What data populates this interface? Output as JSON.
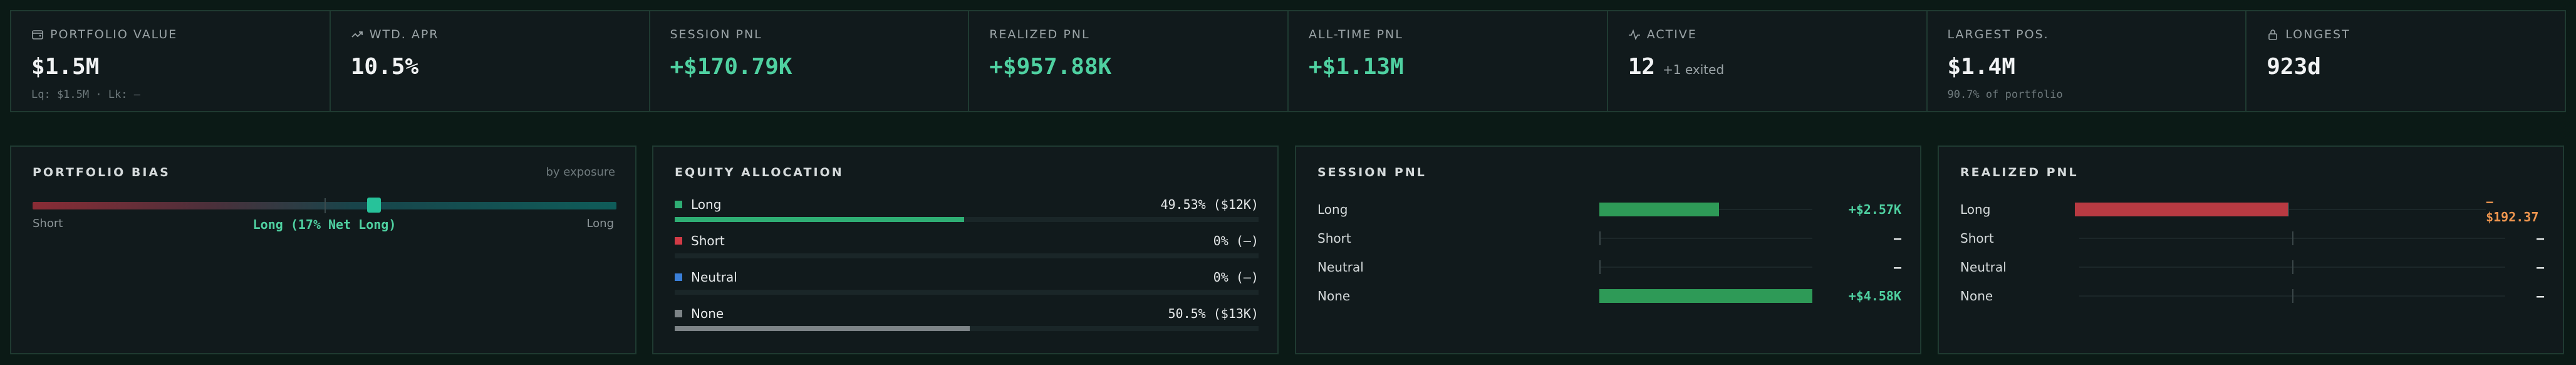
{
  "stats": [
    {
      "label": "PORTFOLIO VALUE",
      "icon": "wallet-icon",
      "value": "$1.5M",
      "sub": "Lq: $1.5M · Lk: —",
      "tone": "white"
    },
    {
      "label": "WTD. APR",
      "icon": "trending-up-icon",
      "value": "10.5%",
      "tone": "white"
    },
    {
      "label": "SESSION PNL",
      "value": "+$170.79K",
      "tone": "green"
    },
    {
      "label": "REALIZED PNL",
      "value": "+$957.88K",
      "tone": "green"
    },
    {
      "label": "ALL-TIME PNL",
      "value": "+$1.13M",
      "tone": "green"
    },
    {
      "label": "ACTIVE",
      "icon": "activity-icon",
      "value": "12",
      "extra": "+1 exited",
      "tone": "white"
    },
    {
      "label": "LARGEST POS.",
      "value": "$1.4M",
      "sub": "90.7% of portfolio",
      "tone": "white"
    },
    {
      "label": "LONGEST",
      "icon": "lock-icon",
      "value": "923d",
      "tone": "white"
    }
  ],
  "bias": {
    "title": "PORTFOLIO BIAS",
    "note": "by exposure",
    "left_label": "Short",
    "right_label": "Long",
    "caption": "Long (17% Net Long)",
    "net_long_pct": 17
  },
  "allocation": {
    "title": "EQUITY ALLOCATION",
    "rows": [
      {
        "label": "Long",
        "value": "49.53% ($12K)",
        "pct": 49.53,
        "color": "#2fae74"
      },
      {
        "label": "Short",
        "value": "0% (—)",
        "pct": 0,
        "color": "#d23b46"
      },
      {
        "label": "Neutral",
        "value": "0% (—)",
        "pct": 0,
        "color": "#3a7fd8"
      },
      {
        "label": "None",
        "value": "50.5% ($13K)",
        "pct": 50.5,
        "color": "#7d8487"
      }
    ]
  },
  "session_pnl": {
    "title": "SESSION PNL",
    "scale_max": 4580,
    "rows": [
      {
        "label": "Long",
        "value": "+$2.57K",
        "amount": 2570,
        "tone": "green"
      },
      {
        "label": "Short",
        "value": "–",
        "amount": 0,
        "tone": "white"
      },
      {
        "label": "Neutral",
        "value": "–",
        "amount": 0,
        "tone": "white"
      },
      {
        "label": "None",
        "value": "+$4.58K",
        "amount": 4580,
        "tone": "green"
      }
    ]
  },
  "realized_pnl": {
    "title": "REALIZED PNL",
    "scale_max": 192.37,
    "rows": [
      {
        "label": "Long",
        "value": "−$192.37",
        "amount": -192.37,
        "tone": "orange"
      },
      {
        "label": "Short",
        "value": "–",
        "amount": 0,
        "tone": "white"
      },
      {
        "label": "Neutral",
        "value": "–",
        "amount": 0,
        "tone": "white"
      },
      {
        "label": "None",
        "value": "–",
        "amount": 0,
        "tone": "white"
      }
    ]
  },
  "colors": {
    "green": "#4fd1a1",
    "bar_green": "#2e9a57",
    "bar_red": "#b83a42",
    "orange": "#f0964f",
    "white": "#e6e9ea"
  }
}
